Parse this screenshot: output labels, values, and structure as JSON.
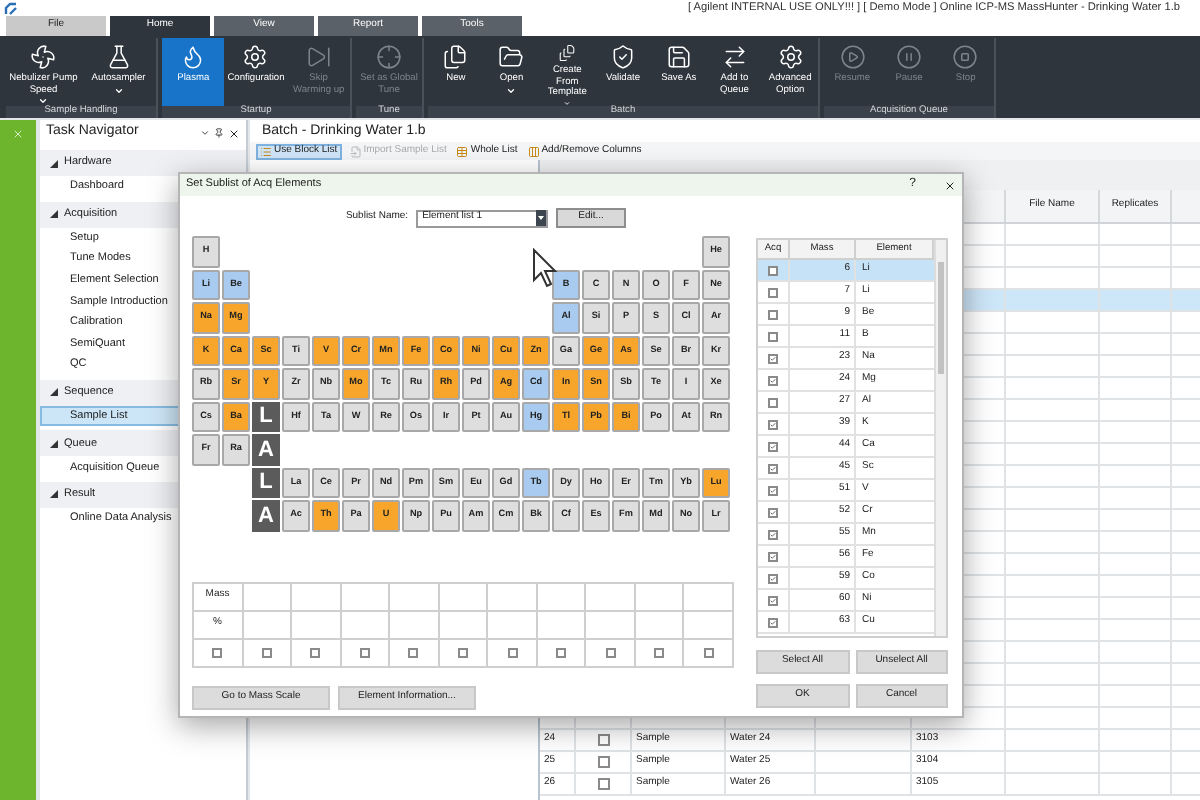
{
  "window": {
    "title": "[ Agilent INTERNAL USE ONLY!!! ] [ Demo Mode ] Online ICP-MS MassHunter - Drinking Water 1.b"
  },
  "tabs": [
    {
      "label": "File",
      "selected": false
    },
    {
      "label": "Home",
      "selected": true
    },
    {
      "label": "View",
      "selected": false
    },
    {
      "label": "Report",
      "selected": false
    },
    {
      "label": "Tools",
      "selected": false
    }
  ],
  "ribbon": {
    "groups": [
      {
        "label": "Sample Handling",
        "buttons": [
          {
            "label": "Nebulizer Pump Speed",
            "selected": false,
            "disabled": false,
            "dropdown": true
          },
          {
            "label": "Autosampler",
            "selected": false,
            "disabled": false,
            "dropdown": true
          }
        ]
      },
      {
        "label": "Startup",
        "buttons": [
          {
            "label": "Plasma",
            "selected": true,
            "disabled": false,
            "dropdown": false
          },
          {
            "label": "Configuration",
            "selected": false,
            "disabled": false,
            "dropdown": false
          },
          {
            "label": "Skip Warming up",
            "selected": false,
            "disabled": true,
            "dropdown": false
          }
        ]
      },
      {
        "label": "Tune",
        "buttons": [
          {
            "label": "Set as Global Tune",
            "selected": false,
            "disabled": true,
            "dropdown": false
          }
        ]
      },
      {
        "label": "Batch",
        "buttons": [
          {
            "label": "New",
            "selected": false,
            "disabled": false,
            "dropdown": false
          },
          {
            "label": "Open",
            "selected": false,
            "disabled": false,
            "dropdown": true
          },
          {
            "label": "Create From Template",
            "selected": false,
            "disabled": false,
            "dropdown": true
          },
          {
            "label": "Validate",
            "selected": false,
            "disabled": false,
            "dropdown": false
          },
          {
            "label": "Save As",
            "selected": false,
            "disabled": false,
            "dropdown": false
          },
          {
            "label": "Add to Queue",
            "selected": false,
            "disabled": false,
            "dropdown": false
          },
          {
            "label": "Advanced Option",
            "selected": false,
            "disabled": false,
            "dropdown": false
          }
        ]
      },
      {
        "label": "Acquisition Queue",
        "buttons": [
          {
            "label": "Resume",
            "selected": false,
            "disabled": true,
            "dropdown": false
          },
          {
            "label": "Pause",
            "selected": false,
            "disabled": true,
            "dropdown": false
          },
          {
            "label": "Stop",
            "selected": false,
            "disabled": true,
            "dropdown": false
          }
        ]
      }
    ]
  },
  "navigator": {
    "title": "Task Navigator",
    "sections": [
      {
        "label": "Hardware",
        "expanded": true,
        "children": [
          {
            "label": "Dashboard",
            "selected": false
          }
        ]
      },
      {
        "label": "Acquisition",
        "expanded": true,
        "children": [
          {
            "label": "Setup",
            "selected": false
          },
          {
            "label": "Tune Modes",
            "selected": false
          },
          {
            "label": "Element Selection",
            "selected": false
          },
          {
            "label": "Sample Introduction",
            "selected": false
          },
          {
            "label": "Calibration",
            "selected": false
          },
          {
            "label": "SemiQuant",
            "selected": false
          },
          {
            "label": "QC",
            "selected": false
          }
        ]
      },
      {
        "label": "Sequence",
        "expanded": true,
        "children": [
          {
            "label": "Sample List",
            "selected": true
          }
        ]
      },
      {
        "label": "Queue",
        "expanded": true,
        "children": [
          {
            "label": "Acquisition Queue",
            "selected": false
          }
        ]
      },
      {
        "label": "Result",
        "expanded": true,
        "children": [
          {
            "label": "Online Data Analysis",
            "selected": false
          }
        ]
      }
    ]
  },
  "batch": {
    "title": "Batch - Drinking Water 1.b",
    "toolbar": [
      {
        "label": "Use Block List",
        "selected": true,
        "disabled": false
      },
      {
        "label": "Import Sample List",
        "selected": false,
        "disabled": true
      },
      {
        "label": "Whole List",
        "selected": false,
        "disabled": false
      },
      {
        "label": "Add/Remove Columns",
        "selected": false,
        "disabled": false
      }
    ],
    "table": {
      "columns": [
        "File Name",
        "Replicates"
      ],
      "rows": [
        {
          "selected": false
        },
        {
          "selected": false
        },
        {
          "selected": false
        },
        {
          "selected": true
        },
        {
          "selected": false
        },
        {
          "selected": false
        },
        {
          "selected": false
        },
        {
          "selected": false
        },
        {
          "selected": false
        },
        {
          "selected": false
        },
        {
          "selected": false
        },
        {
          "selected": false
        },
        {
          "selected": false
        },
        {
          "selected": false
        },
        {
          "selected": false
        },
        {
          "selected": false
        },
        {
          "selected": false
        },
        {
          "selected": false
        },
        {
          "selected": false
        },
        {
          "selected": false
        },
        {
          "selected": false
        },
        {
          "selected": false
        },
        {
          "selected": false
        },
        {
          "selected": false,
          "number": "24",
          "checked": false,
          "type": "Sample",
          "name": "Water 24",
          "value": "3103"
        },
        {
          "selected": false,
          "number": "25",
          "checked": false,
          "type": "Sample",
          "name": "Water 25",
          "value": "3104"
        },
        {
          "selected": false,
          "number": "26",
          "checked": false,
          "type": "Sample",
          "name": "Water 26",
          "value": "3105"
        }
      ]
    }
  },
  "dialog": {
    "title": "Set Sublist of Acq Elements",
    "help": "?",
    "sublist_label": "Sublist Name:",
    "sublist_value": "Element list 1",
    "edit_button": "Edit...",
    "periodic_table": {
      "rows": [
        {
          "left": [
            {
              "kind": "element",
              "symbol": "H",
              "color": "#dedede"
            }
          ],
          "right": [
            {
              "kind": "element",
              "symbol": "He",
              "color": "#dedede"
            }
          ]
        },
        {
          "left": [
            {
              "kind": "element",
              "symbol": "Li",
              "color": "#a9cbef"
            },
            {
              "kind": "element",
              "symbol": "Be",
              "color": "#a9cbef"
            }
          ],
          "right": [
            {
              "kind": "element",
              "symbol": "B",
              "color": "#a9cbef"
            },
            {
              "kind": "element",
              "symbol": "C",
              "color": "#dedede"
            },
            {
              "kind": "element",
              "symbol": "N",
              "color": "#dedede"
            },
            {
              "kind": "element",
              "symbol": "O",
              "color": "#dedede"
            },
            {
              "kind": "element",
              "symbol": "F",
              "color": "#dedede"
            },
            {
              "kind": "element",
              "symbol": "Ne",
              "color": "#dedede"
            }
          ]
        },
        {
          "left": [
            {
              "kind": "element",
              "symbol": "Na",
              "color": "#f7a52b"
            },
            {
              "kind": "element",
              "symbol": "Mg",
              "color": "#f7a52b"
            }
          ],
          "right": [
            {
              "kind": "element",
              "symbol": "Al",
              "color": "#a9cbef"
            },
            {
              "kind": "element",
              "symbol": "Si",
              "color": "#dedede"
            },
            {
              "kind": "element",
              "symbol": "P",
              "color": "#dedede"
            },
            {
              "kind": "element",
              "symbol": "S",
              "color": "#dedede"
            },
            {
              "kind": "element",
              "symbol": "Cl",
              "color": "#dedede"
            },
            {
              "kind": "element",
              "symbol": "Ar",
              "color": "#dedede"
            }
          ]
        },
        {
          "left": [
            {
              "kind": "element",
              "symbol": "K",
              "color": "#f7a52b"
            },
            {
              "kind": "element",
              "symbol": "Ca",
              "color": "#f7a52b"
            },
            {
              "kind": "element",
              "symbol": "Sc",
              "color": "#f7a52b"
            },
            {
              "kind": "element",
              "symbol": "Ti",
              "color": "#dedede"
            },
            {
              "kind": "element",
              "symbol": "V",
              "color": "#f7a52b"
            },
            {
              "kind": "element",
              "symbol": "Cr",
              "color": "#f7a52b"
            },
            {
              "kind": "element",
              "symbol": "Mn",
              "color": "#f7a52b"
            },
            {
              "kind": "element",
              "symbol": "Fe",
              "color": "#f7a52b"
            },
            {
              "kind": "element",
              "symbol": "Co",
              "color": "#f7a52b"
            },
            {
              "kind": "element",
              "symbol": "Ni",
              "color": "#f7a52b"
            },
            {
              "kind": "element",
              "symbol": "Cu",
              "color": "#f7a52b"
            },
            {
              "kind": "element",
              "symbol": "Zn",
              "color": "#f7a52b"
            },
            {
              "kind": "element",
              "symbol": "Ga",
              "color": "#dedede"
            },
            {
              "kind": "element",
              "symbol": "Ge",
              "color": "#f7a52b"
            },
            {
              "kind": "element",
              "symbol": "As",
              "color": "#f7a52b"
            },
            {
              "kind": "element",
              "symbol": "Se",
              "color": "#dedede"
            },
            {
              "kind": "element",
              "symbol": "Br",
              "color": "#dedede"
            },
            {
              "kind": "element",
              "symbol": "Kr",
              "color": "#dedede"
            }
          ],
          "right": []
        },
        {
          "left": [
            {
              "kind": "element",
              "symbol": "Rb",
              "color": "#dedede"
            },
            {
              "kind": "element",
              "symbol": "Sr",
              "color": "#f7a52b"
            },
            {
              "kind": "element",
              "symbol": "Y",
              "color": "#f7a52b"
            },
            {
              "kind": "element",
              "symbol": "Zr",
              "color": "#dedede"
            },
            {
              "kind": "element",
              "symbol": "Nb",
              "color": "#dedede"
            },
            {
              "kind": "element",
              "symbol": "Mo",
              "color": "#f7a52b"
            },
            {
              "kind": "element",
              "symbol": "Tc",
              "color": "#dedede"
            },
            {
              "kind": "element",
              "symbol": "Ru",
              "color": "#dedede"
            },
            {
              "kind": "element",
              "symbol": "Rh",
              "color": "#f7a52b"
            },
            {
              "kind": "element",
              "symbol": "Pd",
              "color": "#dedede"
            },
            {
              "kind": "element",
              "symbol": "Ag",
              "color": "#f7a52b"
            },
            {
              "kind": "element",
              "symbol": "Cd",
              "color": "#a9cbef"
            },
            {
              "kind": "element",
              "symbol": "In",
              "color": "#f7a52b"
            },
            {
              "kind": "element",
              "symbol": "Sn",
              "color": "#f7a52b"
            },
            {
              "kind": "element",
              "symbol": "Sb",
              "color": "#dedede"
            },
            {
              "kind": "element",
              "symbol": "Te",
              "color": "#dedede"
            },
            {
              "kind": "element",
              "symbol": "I",
              "color": "#dedede"
            },
            {
              "kind": "element",
              "symbol": "Xe",
              "color": "#dedede"
            }
          ],
          "right": []
        },
        {
          "left": [
            {
              "kind": "element",
              "symbol": "Cs",
              "color": "#dedede"
            },
            {
              "kind": "element",
              "symbol": "Ba",
              "color": "#f7a52b"
            },
            {
              "kind": "series",
              "symbol": "L"
            },
            {
              "kind": "element",
              "symbol": "Hf",
              "color": "#dedede"
            },
            {
              "kind": "element",
              "symbol": "Ta",
              "color": "#dedede"
            },
            {
              "kind": "element",
              "symbol": "W",
              "color": "#dedede"
            },
            {
              "kind": "element",
              "symbol": "Re",
              "color": "#dedede"
            },
            {
              "kind": "element",
              "symbol": "Os",
              "color": "#dedede"
            },
            {
              "kind": "element",
              "symbol": "Ir",
              "color": "#dedede"
            },
            {
              "kind": "element",
              "symbol": "Pt",
              "color": "#dedede"
            },
            {
              "kind": "element",
              "symbol": "Au",
              "color": "#dedede"
            },
            {
              "kind": "element",
              "symbol": "Hg",
              "color": "#a9cbef"
            },
            {
              "kind": "element",
              "symbol": "Tl",
              "color": "#f7a52b"
            },
            {
              "kind": "element",
              "symbol": "Pb",
              "color": "#f7a52b"
            },
            {
              "kind": "element",
              "symbol": "Bi",
              "color": "#f7a52b"
            },
            {
              "kind": "element",
              "symbol": "Po",
              "color": "#dedede"
            },
            {
              "kind": "element",
              "symbol": "At",
              "color": "#dedede"
            },
            {
              "kind": "element",
              "symbol": "Rn",
              "color": "#dedede"
            }
          ],
          "right": []
        },
        {
          "left": [
            {
              "kind": "element",
              "symbol": "Fr",
              "color": "#dedede"
            },
            {
              "kind": "element",
              "symbol": "Ra",
              "color": "#dedede"
            },
            {
              "kind": "series",
              "symbol": "A"
            }
          ],
          "right": []
        }
      ],
      "series": [
        {
          "label": "L",
          "elements": [
            {
              "symbol": "La",
              "color": "#dedede"
            },
            {
              "symbol": "Ce",
              "color": "#dedede"
            },
            {
              "symbol": "Pr",
              "color": "#dedede"
            },
            {
              "symbol": "Nd",
              "color": "#dedede"
            },
            {
              "symbol": "Pm",
              "color": "#dedede"
            },
            {
              "symbol": "Sm",
              "color": "#dedede"
            },
            {
              "symbol": "Eu",
              "color": "#dedede"
            },
            {
              "symbol": "Gd",
              "color": "#dedede"
            },
            {
              "symbol": "Tb",
              "color": "#a9cbef"
            },
            {
              "symbol": "Dy",
              "color": "#dedede"
            },
            {
              "symbol": "Ho",
              "color": "#dedede"
            },
            {
              "symbol": "Er",
              "color": "#dedede"
            },
            {
              "symbol": "Tm",
              "color": "#dedede"
            },
            {
              "symbol": "Yb",
              "color": "#dedede"
            },
            {
              "symbol": "Lu",
              "color": "#f7a52b"
            }
          ]
        },
        {
          "label": "A",
          "elements": [
            {
              "symbol": "Ac",
              "color": "#dedede"
            },
            {
              "symbol": "Th",
              "color": "#f7a52b"
            },
            {
              "symbol": "Pa",
              "color": "#dedede"
            },
            {
              "symbol": "U",
              "color": "#f7a52b"
            },
            {
              "symbol": "Np",
              "color": "#dedede"
            },
            {
              "symbol": "Pu",
              "color": "#dedede"
            },
            {
              "symbol": "Am",
              "color": "#dedede"
            },
            {
              "symbol": "Cm",
              "color": "#dedede"
            },
            {
              "symbol": "Bk",
              "color": "#dedede"
            },
            {
              "symbol": "Cf",
              "color": "#dedede"
            },
            {
              "symbol": "Es",
              "color": "#dedede"
            },
            {
              "symbol": "Fm",
              "color": "#dedede"
            },
            {
              "symbol": "Md",
              "color": "#dedede"
            },
            {
              "symbol": "No",
              "color": "#dedede"
            },
            {
              "symbol": "Lr",
              "color": "#dedede"
            }
          ]
        }
      ]
    },
    "mass_table": {
      "row_labels": [
        "Mass",
        "%"
      ],
      "checkboxes": [
        false,
        false,
        false,
        false,
        false,
        false,
        false,
        false,
        false,
        false,
        false
      ]
    },
    "left_buttons": [
      "Go to Mass Scale",
      "Element Information..."
    ],
    "list": {
      "columns": [
        "Acq",
        "Mass",
        "Element"
      ],
      "rows": [
        {
          "checked": false,
          "mass": "6",
          "element": "Li",
          "selected": true
        },
        {
          "checked": false,
          "mass": "7",
          "element": "Li",
          "selected": false
        },
        {
          "checked": false,
          "mass": "9",
          "element": "Be",
          "selected": false
        },
        {
          "checked": false,
          "mass": "11",
          "element": "B",
          "selected": false
        },
        {
          "checked": true,
          "mass": "23",
          "element": "Na",
          "selected": false
        },
        {
          "checked": true,
          "mass": "24",
          "element": "Mg",
          "selected": false
        },
        {
          "checked": false,
          "mass": "27",
          "element": "Al",
          "selected": false
        },
        {
          "checked": true,
          "mass": "39",
          "element": "K",
          "selected": false
        },
        {
          "checked": true,
          "mass": "44",
          "element": "Ca",
          "selected": false
        },
        {
          "checked": true,
          "mass": "45",
          "element": "Sc",
          "selected": false
        },
        {
          "checked": true,
          "mass": "51",
          "element": "V",
          "selected": false
        },
        {
          "checked": true,
          "mass": "52",
          "element": "Cr",
          "selected": false
        },
        {
          "checked": true,
          "mass": "55",
          "element": "Mn",
          "selected": false
        },
        {
          "checked": true,
          "mass": "56",
          "element": "Fe",
          "selected": false
        },
        {
          "checked": true,
          "mass": "59",
          "element": "Co",
          "selected": false
        },
        {
          "checked": true,
          "mass": "60",
          "element": "Ni",
          "selected": false
        },
        {
          "checked": true,
          "mass": "63",
          "element": "Cu",
          "selected": false
        }
      ]
    },
    "select_buttons": [
      "Select All",
      "Unselect All"
    ],
    "buttons": [
      "OK",
      "Cancel"
    ]
  }
}
